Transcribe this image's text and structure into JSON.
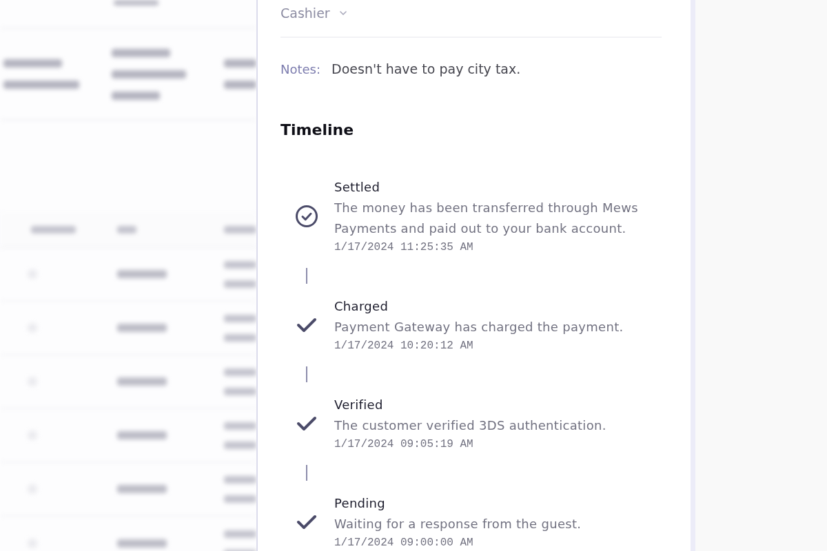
{
  "details": {
    "cashier_label": "Cashier",
    "notes_label": "Notes:",
    "notes": "Doesn't have to pay city tax."
  },
  "timeline": {
    "title": "Timeline",
    "events": [
      {
        "kind": "final",
        "title": "Settled",
        "description": "The money has been transferred through Mews Payments and paid out to your bank account.",
        "timestamp": "1/17/2024 11:25:35 AM"
      },
      {
        "kind": "step",
        "title": "Charged",
        "description": "Payment Gateway has charged the payment.",
        "timestamp": "1/17/2024 10:20:12 AM"
      },
      {
        "kind": "step",
        "title": "Verified",
        "description": "The customer verified 3DS authentication.",
        "timestamp": "1/17/2024 09:05:19 AM"
      },
      {
        "kind": "step",
        "title": "Pending",
        "description": "Waiting for a response from the guest.",
        "timestamp": "1/17/2024 09:00:00 AM"
      }
    ]
  }
}
